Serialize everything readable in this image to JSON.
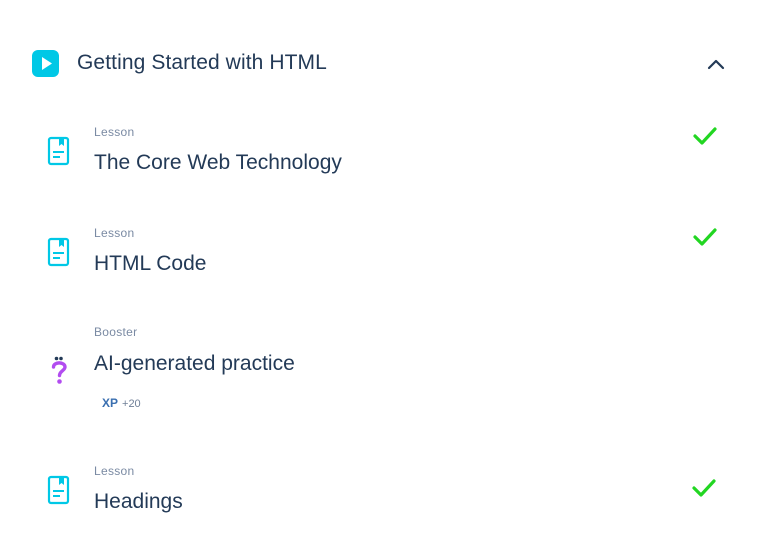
{
  "module": {
    "title": "Getting Started with HTML",
    "icon": "play-icon",
    "toggle_icon": "chevron-up-icon",
    "accent": "#00c8e6"
  },
  "items": [
    {
      "type": "Lesson",
      "title": "The Core Web Technology",
      "icon": "lesson-document-icon",
      "completed": true
    },
    {
      "type": "Lesson",
      "title": "HTML Code",
      "icon": "lesson-document-icon",
      "completed": true
    },
    {
      "type": "Booster",
      "title": "AI-generated practice",
      "icon": "question-mark-icon",
      "completed": false,
      "xp_label": "XP",
      "xp_value": "+20"
    },
    {
      "type": "Lesson",
      "title": "Headings",
      "icon": "lesson-document-icon",
      "completed": true
    }
  ],
  "colors": {
    "check": "#22d622",
    "booster": "#b24cf0",
    "text": "#233a57",
    "muted": "#7a8aa3"
  }
}
